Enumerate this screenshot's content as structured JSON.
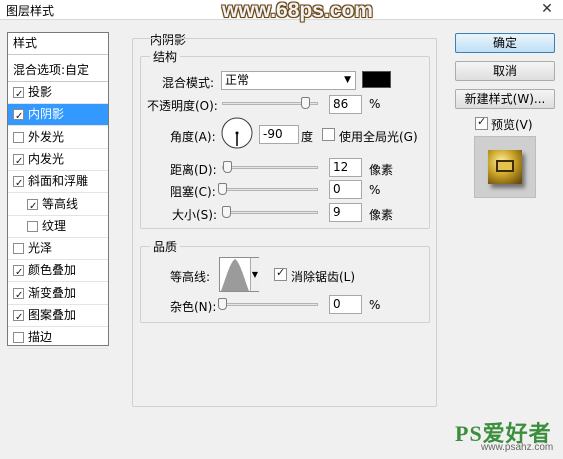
{
  "window": {
    "title": "图层样式",
    "watermark": "www.68ps.com",
    "close_glyph": "✕"
  },
  "style_list": {
    "header": "样式",
    "blend_options": "混合选项:自定",
    "items": [
      {
        "label": "投影",
        "checked": true,
        "indent": false,
        "selected": false
      },
      {
        "label": "内阴影",
        "checked": true,
        "indent": false,
        "selected": true
      },
      {
        "label": "外发光",
        "checked": false,
        "indent": false,
        "selected": false
      },
      {
        "label": "内发光",
        "checked": true,
        "indent": false,
        "selected": false
      },
      {
        "label": "斜面和浮雕",
        "checked": true,
        "indent": false,
        "selected": false
      },
      {
        "label": "等高线",
        "checked": true,
        "indent": true,
        "selected": false
      },
      {
        "label": "纹理",
        "checked": false,
        "indent": true,
        "selected": false
      },
      {
        "label": "光泽",
        "checked": false,
        "indent": false,
        "selected": false
      },
      {
        "label": "颜色叠加",
        "checked": true,
        "indent": false,
        "selected": false
      },
      {
        "label": "渐变叠加",
        "checked": true,
        "indent": false,
        "selected": false
      },
      {
        "label": "图案叠加",
        "checked": true,
        "indent": false,
        "selected": false
      },
      {
        "label": "描边",
        "checked": false,
        "indent": false,
        "selected": false
      }
    ]
  },
  "inner_shadow": {
    "section_title": "内阴影",
    "structure": {
      "title": "结构",
      "blend_mode_label": "混合模式:",
      "blend_mode_value": "正常",
      "color": "#000000",
      "opacity_label": "不透明度(O):",
      "opacity_value": "86",
      "opacity_unit": "%",
      "opacity_fraction": 0.86,
      "angle_label": "角度(A):",
      "angle_value": "-90",
      "angle_unit": "度",
      "global_light_label": "使用全局光(G)",
      "global_light_checked": false,
      "distance_label": "距离(D):",
      "distance_value": "12",
      "distance_unit": "像素",
      "distance_fraction": 0.05,
      "choke_label": "阻塞(C):",
      "choke_value": "0",
      "choke_unit": "%",
      "choke_fraction": 0.0,
      "size_label": "大小(S):",
      "size_value": "9",
      "size_unit": "像素",
      "size_fraction": 0.04
    },
    "quality": {
      "title": "品质",
      "contour_label": "等高线:",
      "antialias_label": "消除锯齿(L)",
      "antialias_checked": true,
      "noise_label": "杂色(N):",
      "noise_value": "0",
      "noise_unit": "%",
      "noise_fraction": 0.0
    }
  },
  "buttons": {
    "ok": "确定",
    "cancel": "取消",
    "new_style": "新建样式(W)...",
    "preview_label": "预览(V)",
    "preview_checked": true
  },
  "footer": {
    "logo": "PS爱好者",
    "site": "www.psahz.com"
  }
}
